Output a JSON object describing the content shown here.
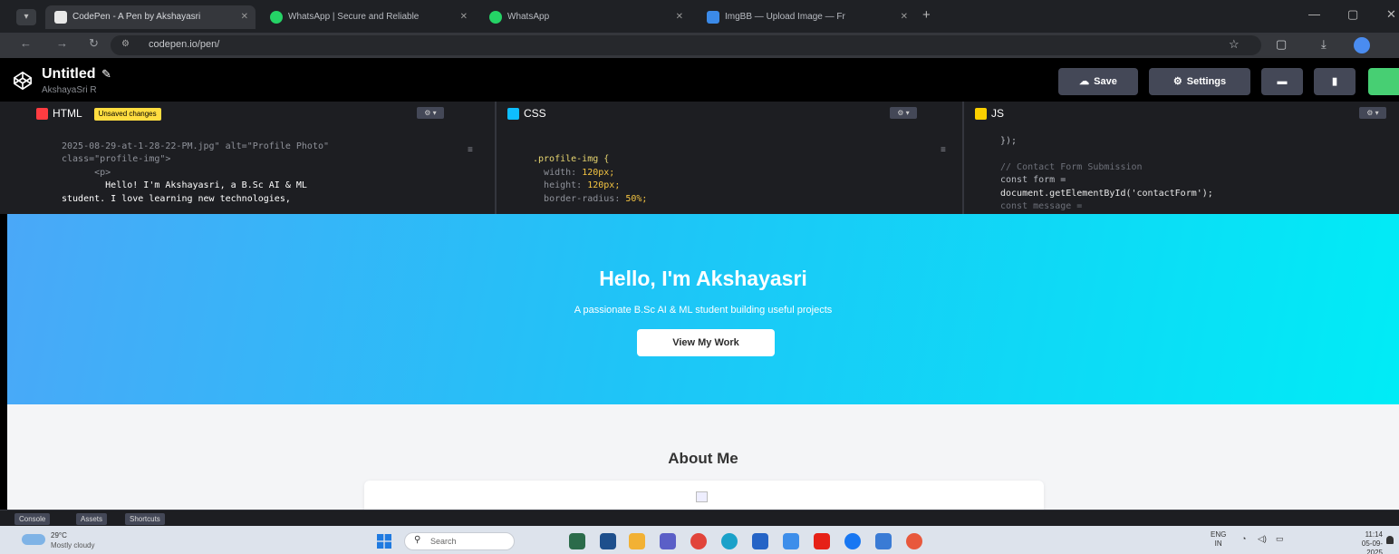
{
  "browser": {
    "tabs": [
      {
        "label": "CodePen - A Pen by Akshayasri",
        "active": true,
        "color": "#e8e8e8"
      },
      {
        "label": "WhatsApp | Secure and Reliable",
        "active": false,
        "color": "#25d366"
      },
      {
        "label": "WhatsApp",
        "active": false,
        "color": "#25d366"
      },
      {
        "label": "ImgBB — Upload Image — Fr",
        "active": false,
        "color": "#3b8ae8"
      }
    ],
    "url": "codepen.io/pen/"
  },
  "codepen": {
    "title": "Untitled",
    "author": "AkshayaSri R",
    "save_label": "Save",
    "settings_label": "Settings",
    "editors": {
      "html": {
        "label": "HTML",
        "badge": "Unsaved changes",
        "color": "#ff3c41",
        "lines": [
          "2025-08-29-at-1-28-22-PM.jpg\" alt=\"Profile Photo\"",
          "class=\"profile-img\">",
          "      <p>",
          "        Hello! I'm Akshayasri, a B.Sc AI & ML",
          "student. I love learning new technologies,"
        ]
      },
      "css": {
        "label": "CSS",
        "color": "#0ebeff",
        "selector": ".profile-img {",
        "props": [
          {
            "name": "width",
            "value": "120px;"
          },
          {
            "name": "height",
            "value": "120px;"
          },
          {
            "name": "border-radius",
            "value": "50%;"
          }
        ]
      },
      "js": {
        "label": "JS",
        "color": "#fcd000",
        "lines": [
          "});",
          "",
          "// Contact Form Submission",
          "const form =",
          "document.getElementById('contactForm');",
          "const message ="
        ]
      }
    },
    "footer": {
      "console": "Console",
      "assets": "Assets",
      "shortcuts": "Shortcuts"
    }
  },
  "preview": {
    "hero_title": "Hello, I'm Akshayasri",
    "hero_subtitle": "A passionate B.Sc AI & ML student building useful projects",
    "cta_label": "View My Work",
    "about_title": "About Me"
  },
  "taskbar": {
    "temperature": "29°C",
    "weather": "Mostly cloudy",
    "search_placeholder": "Search",
    "lang_line1": "ENG",
    "lang_line2": "IN",
    "time": "11:14",
    "date": "05-09-2025"
  }
}
